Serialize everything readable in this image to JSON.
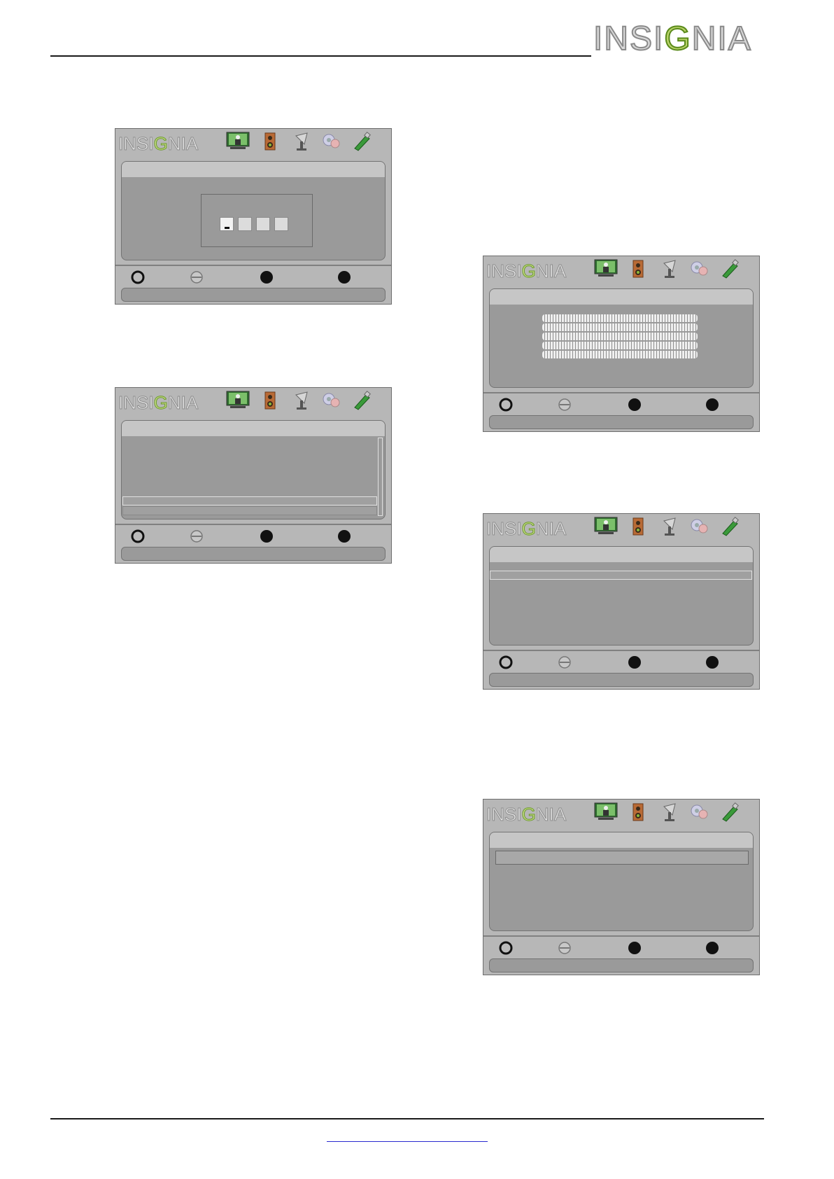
{
  "header": {
    "brand": "INSIGNIA",
    "brand_parts": {
      "before": "INSI",
      "ring": "G",
      "after": "NIA"
    }
  },
  "osd": {
    "logo_before": "INSI",
    "logo_ring": "G",
    "logo_after": "NIA",
    "icons": [
      "picture-icon",
      "audio-icon",
      "channels-icon",
      "settings-icon",
      "usb-icon"
    ],
    "controls": [
      "move-icon",
      "select-icon",
      "menu-button-icon",
      "exit-button-icon"
    ]
  },
  "colors": {
    "osd_background": "#b7b7b7",
    "osd_panel": "#9a9a9a",
    "logo_accent": "#6a9a2a",
    "footer_link": "#2a2ad0"
  }
}
